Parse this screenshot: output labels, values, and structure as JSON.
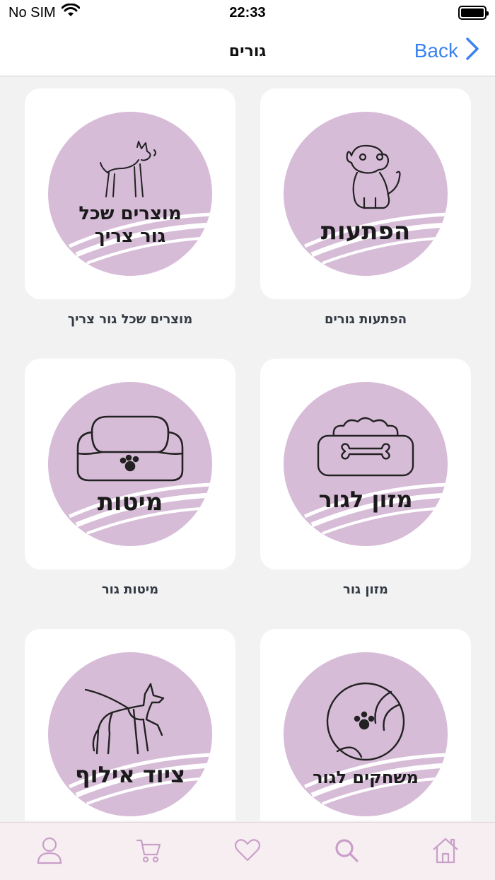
{
  "status_bar": {
    "carrier": "No SIM",
    "time": "22:33"
  },
  "nav": {
    "title": "גורים",
    "back_label": "Back"
  },
  "categories": [
    {
      "circle_lines": [
        "הפתעות"
      ],
      "label": "הפתעות גורים"
    },
    {
      "circle_lines": [
        "מוצרים שכל",
        "גור צריך"
      ],
      "label": "מוצרים שכל גור צריך"
    },
    {
      "circle_lines": [
        "מזון לגור"
      ],
      "label": "מזון גור"
    },
    {
      "circle_lines": [
        "מיטות"
      ],
      "label": "מיטות גור"
    },
    {
      "circle_lines": [
        "משחקים לגור"
      ],
      "label": ""
    },
    {
      "circle_lines": [
        "ציוד אילוף"
      ],
      "label": ""
    }
  ],
  "tab_bar": {
    "items": [
      "home-icon",
      "search-icon",
      "heart-icon",
      "cart-icon",
      "user-icon"
    ]
  },
  "colors": {
    "accent": "#3a82f0",
    "circle": "#d7bcd8",
    "tab_icon": "#c99fc9",
    "tab_bg": "#f7eef1"
  }
}
